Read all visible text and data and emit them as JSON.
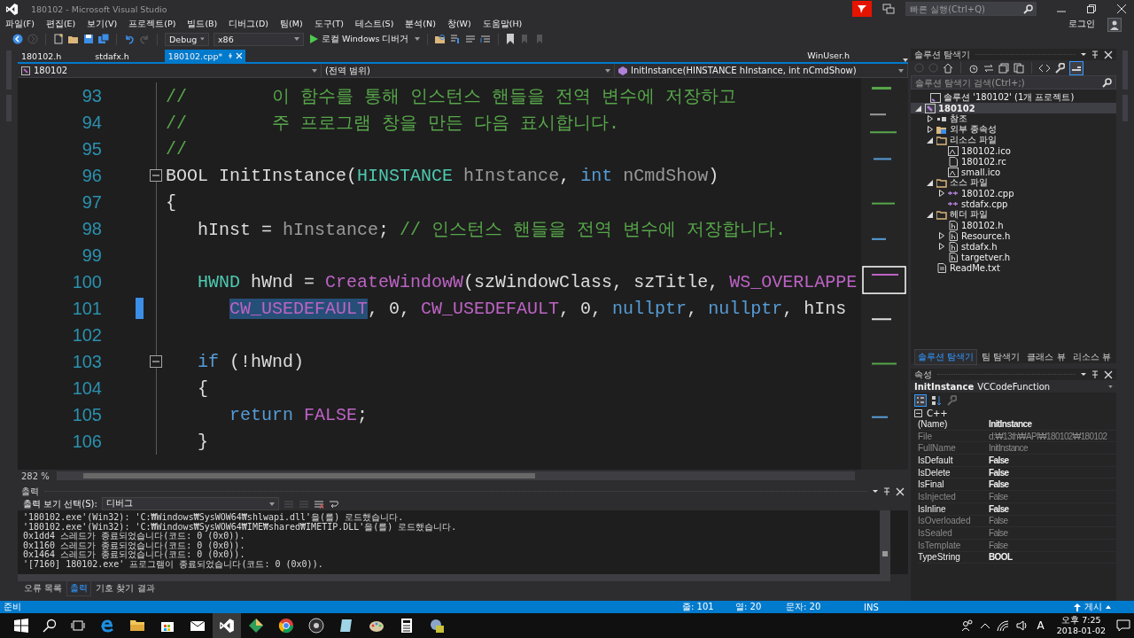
{
  "window": {
    "title": "180102 - Microsoft Visual Studio",
    "quick_launch": {
      "placeholder": "빠른 실행(Ctrl+Q)"
    },
    "account": "로그인"
  },
  "menu": [
    "파일(F)",
    "편집(E)",
    "보기(V)",
    "프로젝트(P)",
    "빌드(B)",
    "디버그(D)",
    "팀(M)",
    "도구(T)",
    "테스트(S)",
    "분석(N)",
    "창(W)",
    "도움말(H)"
  ],
  "toolbar": {
    "configuration": "Debug",
    "platform": "x86",
    "run": "로컬 Windows 디버거"
  },
  "doc_tabs": [
    {
      "label": "180102.h",
      "selected": false
    },
    {
      "label": "stdafx.h",
      "selected": false
    },
    {
      "label": "180102.cpp*",
      "selected": true
    }
  ],
  "preview_tab": "WinUser.h",
  "nav": {
    "project": "180102",
    "scope": "(전역 범위)",
    "member": "InitInstance(HINSTANCE hInstance, int nCmdShow)"
  },
  "code_lines": [
    {
      "number": "93",
      "marker": false,
      "fold": false,
      "tokens": [
        {
          "text": "//        이 함수를 통해 인스턴스 핸들을 전역 변수에 저장하고",
          "kind": "comment",
          "selected": false
        }
      ]
    },
    {
      "number": "94",
      "marker": false,
      "fold": false,
      "tokens": [
        {
          "text": "//        주 프로그램 창을 만든 다음 표시합니다.",
          "kind": "comment",
          "selected": false
        }
      ]
    },
    {
      "number": "95",
      "marker": false,
      "fold": false,
      "tokens": [
        {
          "text": "//",
          "kind": "comment",
          "selected": false
        }
      ]
    },
    {
      "number": "96",
      "marker": false,
      "fold": true,
      "tokens": [
        {
          "text": "BOOL",
          "kind": "plain",
          "selected": false
        },
        {
          "text": " InitInstance(",
          "kind": "plain",
          "selected": false
        },
        {
          "text": "HINSTANCE",
          "kind": "type",
          "selected": false
        },
        {
          "text": " hInstance",
          "kind": "param",
          "selected": false
        },
        {
          "text": ", ",
          "kind": "plain",
          "selected": false
        },
        {
          "text": "int",
          "kind": "keyword",
          "selected": false
        },
        {
          "text": " nCmdShow",
          "kind": "param",
          "selected": false
        },
        {
          "text": ")",
          "kind": "plain",
          "selected": false
        }
      ]
    },
    {
      "number": "97",
      "marker": false,
      "fold": false,
      "tokens": [
        {
          "text": "{",
          "kind": "plain",
          "selected": false
        }
      ]
    },
    {
      "number": "98",
      "marker": false,
      "fold": false,
      "tokens": [
        {
          "text": "   hInst = ",
          "kind": "plain",
          "selected": false
        },
        {
          "text": "hInstance",
          "kind": "param",
          "selected": false
        },
        {
          "text": "; ",
          "kind": "plain",
          "selected": false
        },
        {
          "text": "// 인스턴스 핸들을 전역 변수에 저장합니다.",
          "kind": "comment",
          "selected": false
        }
      ]
    },
    {
      "number": "99",
      "marker": false,
      "fold": false
    },
    {
      "number": "100",
      "marker": false,
      "fold": false,
      "tokens": [
        {
          "text": "   HWND",
          "kind": "type",
          "selected": false
        },
        {
          "text": " hWnd = ",
          "kind": "plain",
          "selected": false
        },
        {
          "text": "CreateWindowW",
          "kind": "macro",
          "selected": false
        },
        {
          "text": "(szWindowClass, szTitle, ",
          "kind": "plain",
          "selected": false
        },
        {
          "text": "WS_OVERLAPPE",
          "kind": "macro",
          "selected": false
        }
      ]
    },
    {
      "number": "101",
      "marker": true,
      "fold": false,
      "tokens": [
        {
          "text": "      CW_USEDEFAULT",
          "kind": "macro",
          "selected": true
        },
        {
          "text": ", 0, ",
          "kind": "plain",
          "selected": false
        },
        {
          "text": "CW_USEDEFAULT",
          "kind": "macro",
          "selected": false
        },
        {
          "text": ", 0, ",
          "kind": "plain",
          "selected": false
        },
        {
          "text": "nullptr",
          "kind": "keyword",
          "selected": false
        },
        {
          "text": ", ",
          "kind": "plain",
          "selected": false
        },
        {
          "text": "nullptr",
          "kind": "keyword",
          "selected": false
        },
        {
          "text": ", hIns",
          "kind": "plain",
          "selected": false
        }
      ]
    },
    {
      "number": "102",
      "marker": false,
      "fold": false
    },
    {
      "number": "103",
      "marker": false,
      "fold": true,
      "tokens": [
        {
          "text": "   if",
          "kind": "keyword",
          "selected": false
        },
        {
          "text": " (!hWnd)",
          "kind": "plain",
          "selected": false
        }
      ]
    },
    {
      "number": "104",
      "marker": false,
      "fold": false,
      "tokens": [
        {
          "text": "   {",
          "kind": "plain",
          "selected": false
        }
      ]
    },
    {
      "number": "105",
      "marker": false,
      "fold": false,
      "tokens": [
        {
          "text": "      return",
          "kind": "keyword",
          "selected": false
        },
        {
          "text": " FALSE",
          "kind": "macro",
          "selected": false
        },
        {
          "text": ";",
          "kind": "plain",
          "selected": false
        }
      ]
    },
    {
      "number": "106",
      "marker": false,
      "fold": false,
      "tokens": [
        {
          "text": "   }",
          "kind": "plain",
          "selected": false
        }
      ]
    }
  ],
  "zoom": "282 %",
  "output": {
    "title": "출력",
    "source_label": "출력 보기 선택(S):",
    "source": "디버그",
    "lines": [
      "'180102.exe'(Win32): 'C:₩Windows₩SysWOW64₩shlwapi.dll'을(를) 로드했습니다.",
      "'180102.exe'(Win32): 'C:₩Windows₩SysWOW64₩IME₩shared₩IMETIP.DLL'을(를) 로드했습니다.",
      "0x1dd4 스레드가 종료되었습니다(코드: 0 (0x0)).",
      "0x1160 스레드가 종료되었습니다(코드: 0 (0x0)).",
      "0x1464 스레드가 종료되었습니다(코드: 0 (0x0)).",
      "'[7160] 180102.exe' 프로그램이 종료되었습니다(코드: 0 (0x0))."
    ]
  },
  "bottom_tabs": [
    {
      "label": "오류 목록",
      "selected": false
    },
    {
      "label": "출력",
      "selected": true
    },
    {
      "label": "기호 찾기 결과",
      "selected": false
    }
  ],
  "solution_explorer": {
    "title": "솔루션 탐색기",
    "search": {
      "placeholder": "솔루션 탐색기 검색(Ctrl+;)"
    },
    "tree": [
      {
        "label": "솔루션 '180102' (1개 프로젝트)",
        "kind": "solution",
        "selected": false,
        "children": [
          {
            "label": "180102",
            "kind": "project",
            "selected": true,
            "expanded": true,
            "children": [
              {
                "label": "참조",
                "kind": "references",
                "selected": false,
                "expanded": false
              },
              {
                "label": "외부 종속성",
                "kind": "deps",
                "selected": false,
                "expanded": false
              },
              {
                "label": "리소스 파일",
                "kind": "folder",
                "selected": false,
                "expanded": true,
                "children": [
                  {
                    "label": "180102.ico",
                    "kind": "image",
                    "selected": false
                  },
                  {
                    "label": "180102.rc",
                    "kind": "resource",
                    "selected": false
                  },
                  {
                    "label": "small.ico",
                    "kind": "image",
                    "selected": false
                  }
                ]
              },
              {
                "label": "소스 파일",
                "kind": "folder",
                "selected": false,
                "expanded": true,
                "children": [
                  {
                    "label": "180102.cpp",
                    "kind": "cpp",
                    "selected": false,
                    "expanded": false
                  },
                  {
                    "label": "stdafx.cpp",
                    "kind": "cpp",
                    "selected": false
                  }
                ]
              },
              {
                "label": "헤더 파일",
                "kind": "folder",
                "selected": false,
                "expanded": true,
                "children": [
                  {
                    "label": "180102.h",
                    "kind": "header",
                    "selected": false
                  },
                  {
                    "label": "Resource.h",
                    "kind": "header",
                    "selected": false,
                    "expanded": false
                  },
                  {
                    "label": "stdafx.h",
                    "kind": "header",
                    "selected": false,
                    "expanded": false
                  },
                  {
                    "label": "targetver.h",
                    "kind": "header",
                    "selected": false
                  }
                ]
              },
              {
                "label": "ReadMe.txt",
                "kind": "text",
                "selected": false
              }
            ]
          }
        ]
      }
    ],
    "tabs": [
      {
        "label": "솔루션 탐색기",
        "selected": true
      },
      {
        "label": "팀 탐색기",
        "selected": false
      },
      {
        "label": "클래스 뷰",
        "selected": false
      },
      {
        "label": "리소스 뷰",
        "selected": false
      }
    ]
  },
  "properties": {
    "title": "속성",
    "object_name": "InitInstance",
    "object_type": "VCCodeFunction",
    "category": "C++",
    "rows": [
      {
        "name": "(Name)",
        "value": "InitInstance",
        "disabled": false
      },
      {
        "name": "File",
        "value": "d:₩13th₩API₩180102₩180102",
        "disabled": true
      },
      {
        "name": "FullName",
        "value": "InitInstance",
        "disabled": true
      },
      {
        "name": "IsDefault",
        "value": "False",
        "disabled": false
      },
      {
        "name": "IsDelete",
        "value": "False",
        "disabled": false
      },
      {
        "name": "IsFinal",
        "value": "False",
        "disabled": false
      },
      {
        "name": "IsInjected",
        "value": "False",
        "disabled": true
      },
      {
        "name": "IsInline",
        "value": "False",
        "disabled": false
      },
      {
        "name": "IsOverloaded",
        "value": "False",
        "disabled": true
      },
      {
        "name": "IsSealed",
        "value": "False",
        "disabled": true
      },
      {
        "name": "IsTemplate",
        "value": "False",
        "disabled": true
      },
      {
        "name": "TypeString",
        "value": "BOOL",
        "disabled": false
      }
    ]
  },
  "status_bar": {
    "message": "준비",
    "line": "줄: 101",
    "column": "열: 20",
    "char": "문자: 20",
    "mode": "INS",
    "publish": "게시"
  },
  "taskbar": {
    "input": "A",
    "time": "오후 7:25",
    "date": "2018-01-02"
  }
}
